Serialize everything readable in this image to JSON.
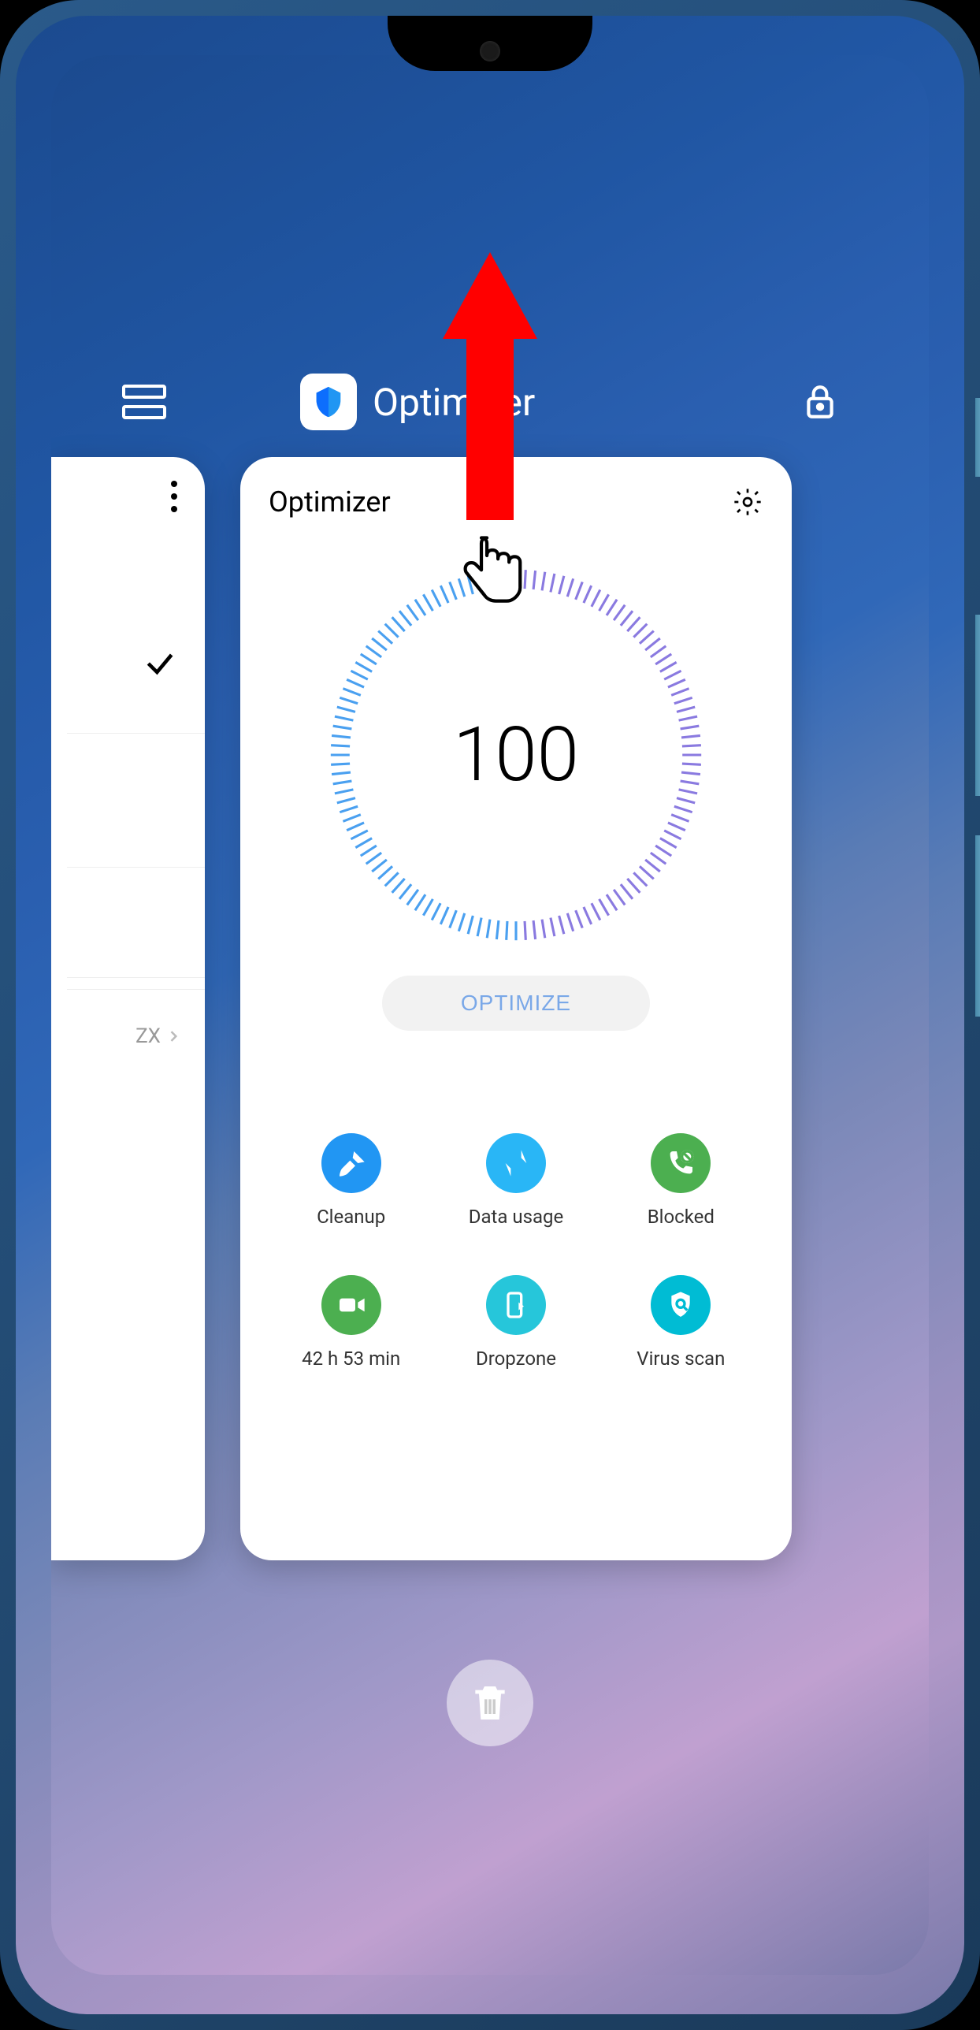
{
  "recents": {
    "appTitle": "Optimizer"
  },
  "prevCard": {
    "tag": "ZX"
  },
  "optimizer": {
    "title": "Optimizer",
    "score": "100",
    "optimizeLabel": "OPTIMIZE",
    "items": [
      {
        "label": "Cleanup"
      },
      {
        "label": "Data usage"
      },
      {
        "label": "Blocked"
      },
      {
        "label": "42 h 53 min"
      },
      {
        "label": "Dropzone"
      },
      {
        "label": "Virus scan"
      }
    ]
  }
}
